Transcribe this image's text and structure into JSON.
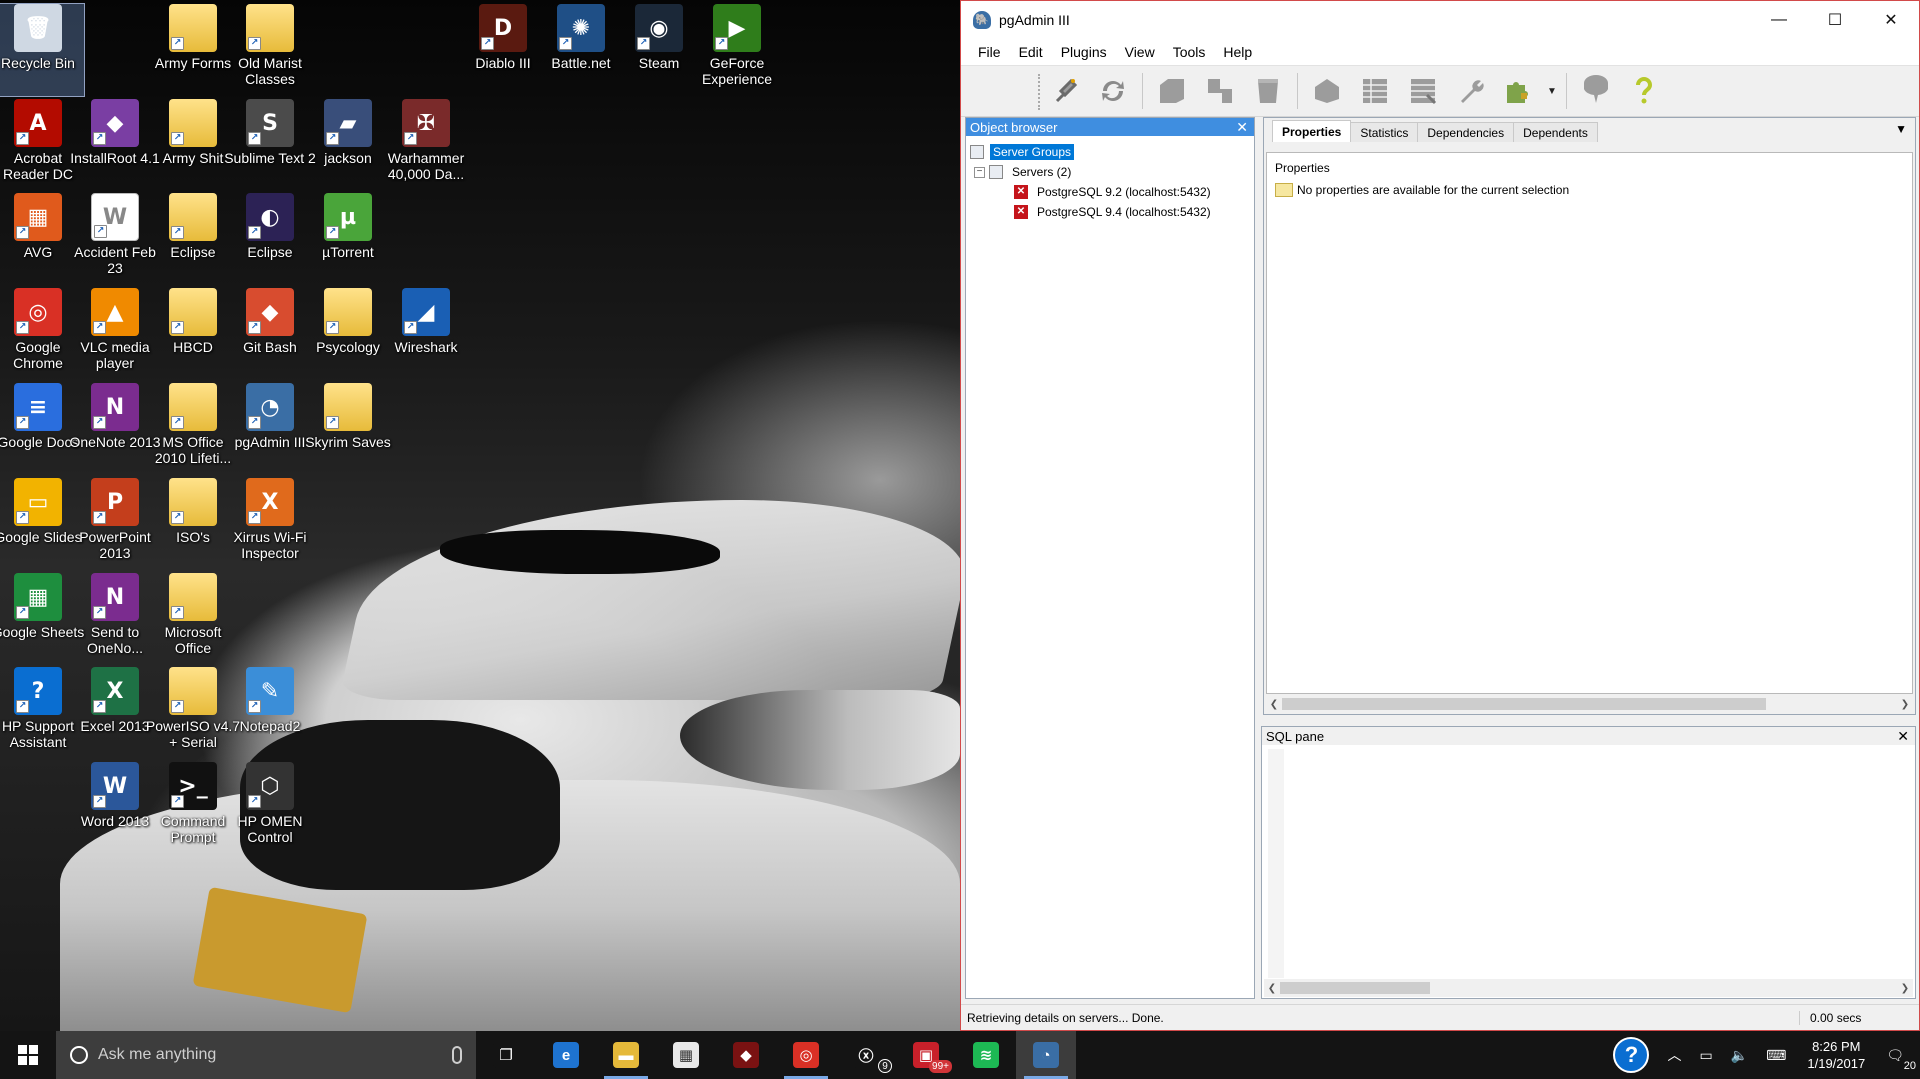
{
  "desktop": {
    "icons": [
      {
        "label": "Recycle Bin",
        "glyph": "🗑",
        "color": "#cfd8e3",
        "col": 0,
        "row": 0,
        "selected": true
      },
      {
        "label": "Army Forms",
        "glyph": "",
        "kind": "folder-doc",
        "col": 2,
        "row": 0
      },
      {
        "label": "Old Marist Classes",
        "glyph": "",
        "kind": "folder-doc",
        "col": 3,
        "row": 0
      },
      {
        "label": "Diablo III",
        "glyph": "D",
        "color": "#5a1a10",
        "col": 6,
        "row": 0
      },
      {
        "label": "Battle.net",
        "glyph": "✺",
        "color": "#1f4f86",
        "col": 7,
        "row": 0
      },
      {
        "label": "Steam",
        "glyph": "◉",
        "color": "#1b2838",
        "col": 8,
        "row": 0
      },
      {
        "label": "GeForce Experience",
        "glyph": "▶",
        "color": "#2f7d1b",
        "col": 9,
        "row": 0
      },
      {
        "label": "Acrobat Reader DC",
        "glyph": "A",
        "color": "#b30b00",
        "col": 0,
        "row": 1
      },
      {
        "label": "InstallRoot 4.1",
        "glyph": "◆",
        "color": "#7a3ea3",
        "col": 1,
        "row": 1
      },
      {
        "label": "Army Shit",
        "glyph": "",
        "kind": "folder-doc",
        "col": 2,
        "row": 1
      },
      {
        "label": "Sublime Text 2",
        "glyph": "S",
        "color": "#4b4b4b",
        "col": 3,
        "row": 1
      },
      {
        "label": "jackson",
        "glyph": "▰",
        "color": "#394e7a",
        "col": 4,
        "row": 1
      },
      {
        "label": "Warhammer 40,000 Da...",
        "glyph": "✠",
        "color": "#7a2a2a",
        "col": 5,
        "row": 1
      },
      {
        "label": "AVG",
        "glyph": "▦",
        "color": "#e05a1c",
        "col": 0,
        "row": 2
      },
      {
        "label": "Accident Feb 23",
        "glyph": "W",
        "kind": "doc",
        "col": 1,
        "row": 2
      },
      {
        "label": "Eclipse",
        "glyph": "",
        "kind": "folder",
        "col": 2,
        "row": 2
      },
      {
        "label": "Eclipse",
        "glyph": "◐",
        "color": "#2c2255",
        "col": 3,
        "row": 2
      },
      {
        "label": "µTorrent",
        "glyph": "µ",
        "color": "#4aa53a",
        "col": 4,
        "row": 2
      },
      {
        "label": "Google Chrome",
        "glyph": "◎",
        "color": "#d93025",
        "col": 0,
        "row": 3
      },
      {
        "label": "VLC media player",
        "glyph": "▲",
        "color": "#f08a00",
        "col": 1,
        "row": 3
      },
      {
        "label": "HBCD",
        "glyph": "",
        "kind": "folder",
        "col": 2,
        "row": 3
      },
      {
        "label": "Git Bash",
        "glyph": "◆",
        "color": "#d84c2f",
        "col": 3,
        "row": 3
      },
      {
        "label": "Psycology",
        "glyph": "",
        "kind": "folder",
        "col": 4,
        "row": 3
      },
      {
        "label": "Wireshark",
        "glyph": "◢",
        "color": "#1a5fb4",
        "col": 5,
        "row": 3
      },
      {
        "label": "Google Docs",
        "glyph": "≡",
        "color": "#2a6ede",
        "col": 0,
        "row": 4
      },
      {
        "label": "OneNote 2013",
        "glyph": "N",
        "color": "#7b2c8f",
        "col": 1,
        "row": 4
      },
      {
        "label": "MS Office 2010 Lifeti...",
        "glyph": "",
        "kind": "folder-doc",
        "col": 2,
        "row": 4
      },
      {
        "label": "pgAdmin III",
        "glyph": "◔",
        "color": "#3a6ea5",
        "col": 3,
        "row": 4
      },
      {
        "label": "Skyrim Saves",
        "glyph": "",
        "kind": "folder",
        "col": 4,
        "row": 4
      },
      {
        "label": "Google Slides",
        "glyph": "▭",
        "color": "#f2b300",
        "col": 0,
        "row": 5
      },
      {
        "label": "PowerPoint 2013",
        "glyph": "P",
        "color": "#c43e1c",
        "col": 1,
        "row": 5
      },
      {
        "label": "ISO's",
        "glyph": "",
        "kind": "folder",
        "col": 2,
        "row": 5
      },
      {
        "label": "Xirrus Wi-Fi Inspector",
        "glyph": "X",
        "color": "#e06a1c",
        "col": 3,
        "row": 5
      },
      {
        "label": "Google Sheets",
        "glyph": "▦",
        "color": "#1e8e3e",
        "col": 0,
        "row": 6
      },
      {
        "label": "Send to OneNo...",
        "glyph": "N",
        "color": "#7b2c8f",
        "col": 1,
        "row": 6
      },
      {
        "label": "Microsoft Office",
        "glyph": "",
        "kind": "folder-doc",
        "col": 2,
        "row": 6
      },
      {
        "label": "HP Support Assistant",
        "glyph": "?",
        "color": "#0a6ed1",
        "col": 0,
        "row": 7
      },
      {
        "label": "Excel 2013",
        "glyph": "X",
        "color": "#1e7145",
        "col": 1,
        "row": 7
      },
      {
        "label": "PowerISO v4.7 + Serial",
        "glyph": "",
        "kind": "folder-doc",
        "col": 2,
        "row": 7
      },
      {
        "label": "Notepad2",
        "glyph": "✎",
        "color": "#3b8ed8",
        "col": 3,
        "row": 7
      },
      {
        "label": "Word 2013",
        "glyph": "W",
        "color": "#2b579a",
        "col": 1,
        "row": 8
      },
      {
        "label": "Command Prompt",
        "glyph": ">_",
        "color": "#111111",
        "col": 2,
        "row": 8
      },
      {
        "label": "HP OMEN Control",
        "glyph": "⬡",
        "color": "#333333",
        "col": 3,
        "row": 8
      }
    ]
  },
  "pgadmin": {
    "title": "pgAdmin III",
    "window_buttons": [
      "—",
      "☐",
      "✕"
    ],
    "menu": [
      "File",
      "Edit",
      "Plugins",
      "View",
      "Tools",
      "Help"
    ],
    "object_browser": {
      "title": "Object browser",
      "tree": {
        "root": "Server Groups",
        "servers_label": "Servers (2)",
        "servers": [
          "PostgreSQL 9.2 (localhost:5432)",
          "PostgreSQL 9.4 (localhost:5432)"
        ]
      }
    },
    "properties": {
      "tabs": [
        "Properties",
        "Statistics",
        "Dependencies",
        "Dependents"
      ],
      "active_tab": "Properties",
      "heading": "Properties",
      "message": "No properties are available for the current selection"
    },
    "sql_pane": {
      "title": "SQL pane"
    },
    "status": {
      "text": "Retrieving details on servers... Done.",
      "time": "0.00 secs"
    }
  },
  "taskbar": {
    "search_placeholder": "Ask me anything",
    "apps": [
      {
        "name": "task-view",
        "glyph": "❐",
        "color": "#141414"
      },
      {
        "name": "edge",
        "glyph": "e",
        "color": "#1e73d0"
      },
      {
        "name": "file-explorer",
        "glyph": "▬",
        "color": "#e5b93a",
        "running": true
      },
      {
        "name": "store",
        "glyph": "▦",
        "color": "#e8e8e8"
      },
      {
        "name": "diablo",
        "glyph": "◆",
        "color": "#7a1212"
      },
      {
        "name": "chrome",
        "glyph": "◎",
        "color": "#d93025",
        "running": true
      },
      {
        "name": "xbox",
        "glyph": "ⓧ",
        "color": "#141414",
        "badge": "9",
        "badge_style": "dark"
      },
      {
        "name": "notifications-app",
        "glyph": "▣",
        "color": "#c8202a",
        "badge": "99+"
      },
      {
        "name": "spotify",
        "glyph": "≋",
        "color": "#1db954"
      },
      {
        "name": "pgadmin",
        "glyph": "◔",
        "color": "#3a6ea5",
        "running": true,
        "active": true
      }
    ],
    "clock": {
      "time": "8:26 PM",
      "date": "1/19/2017"
    },
    "notification_count": "20"
  }
}
